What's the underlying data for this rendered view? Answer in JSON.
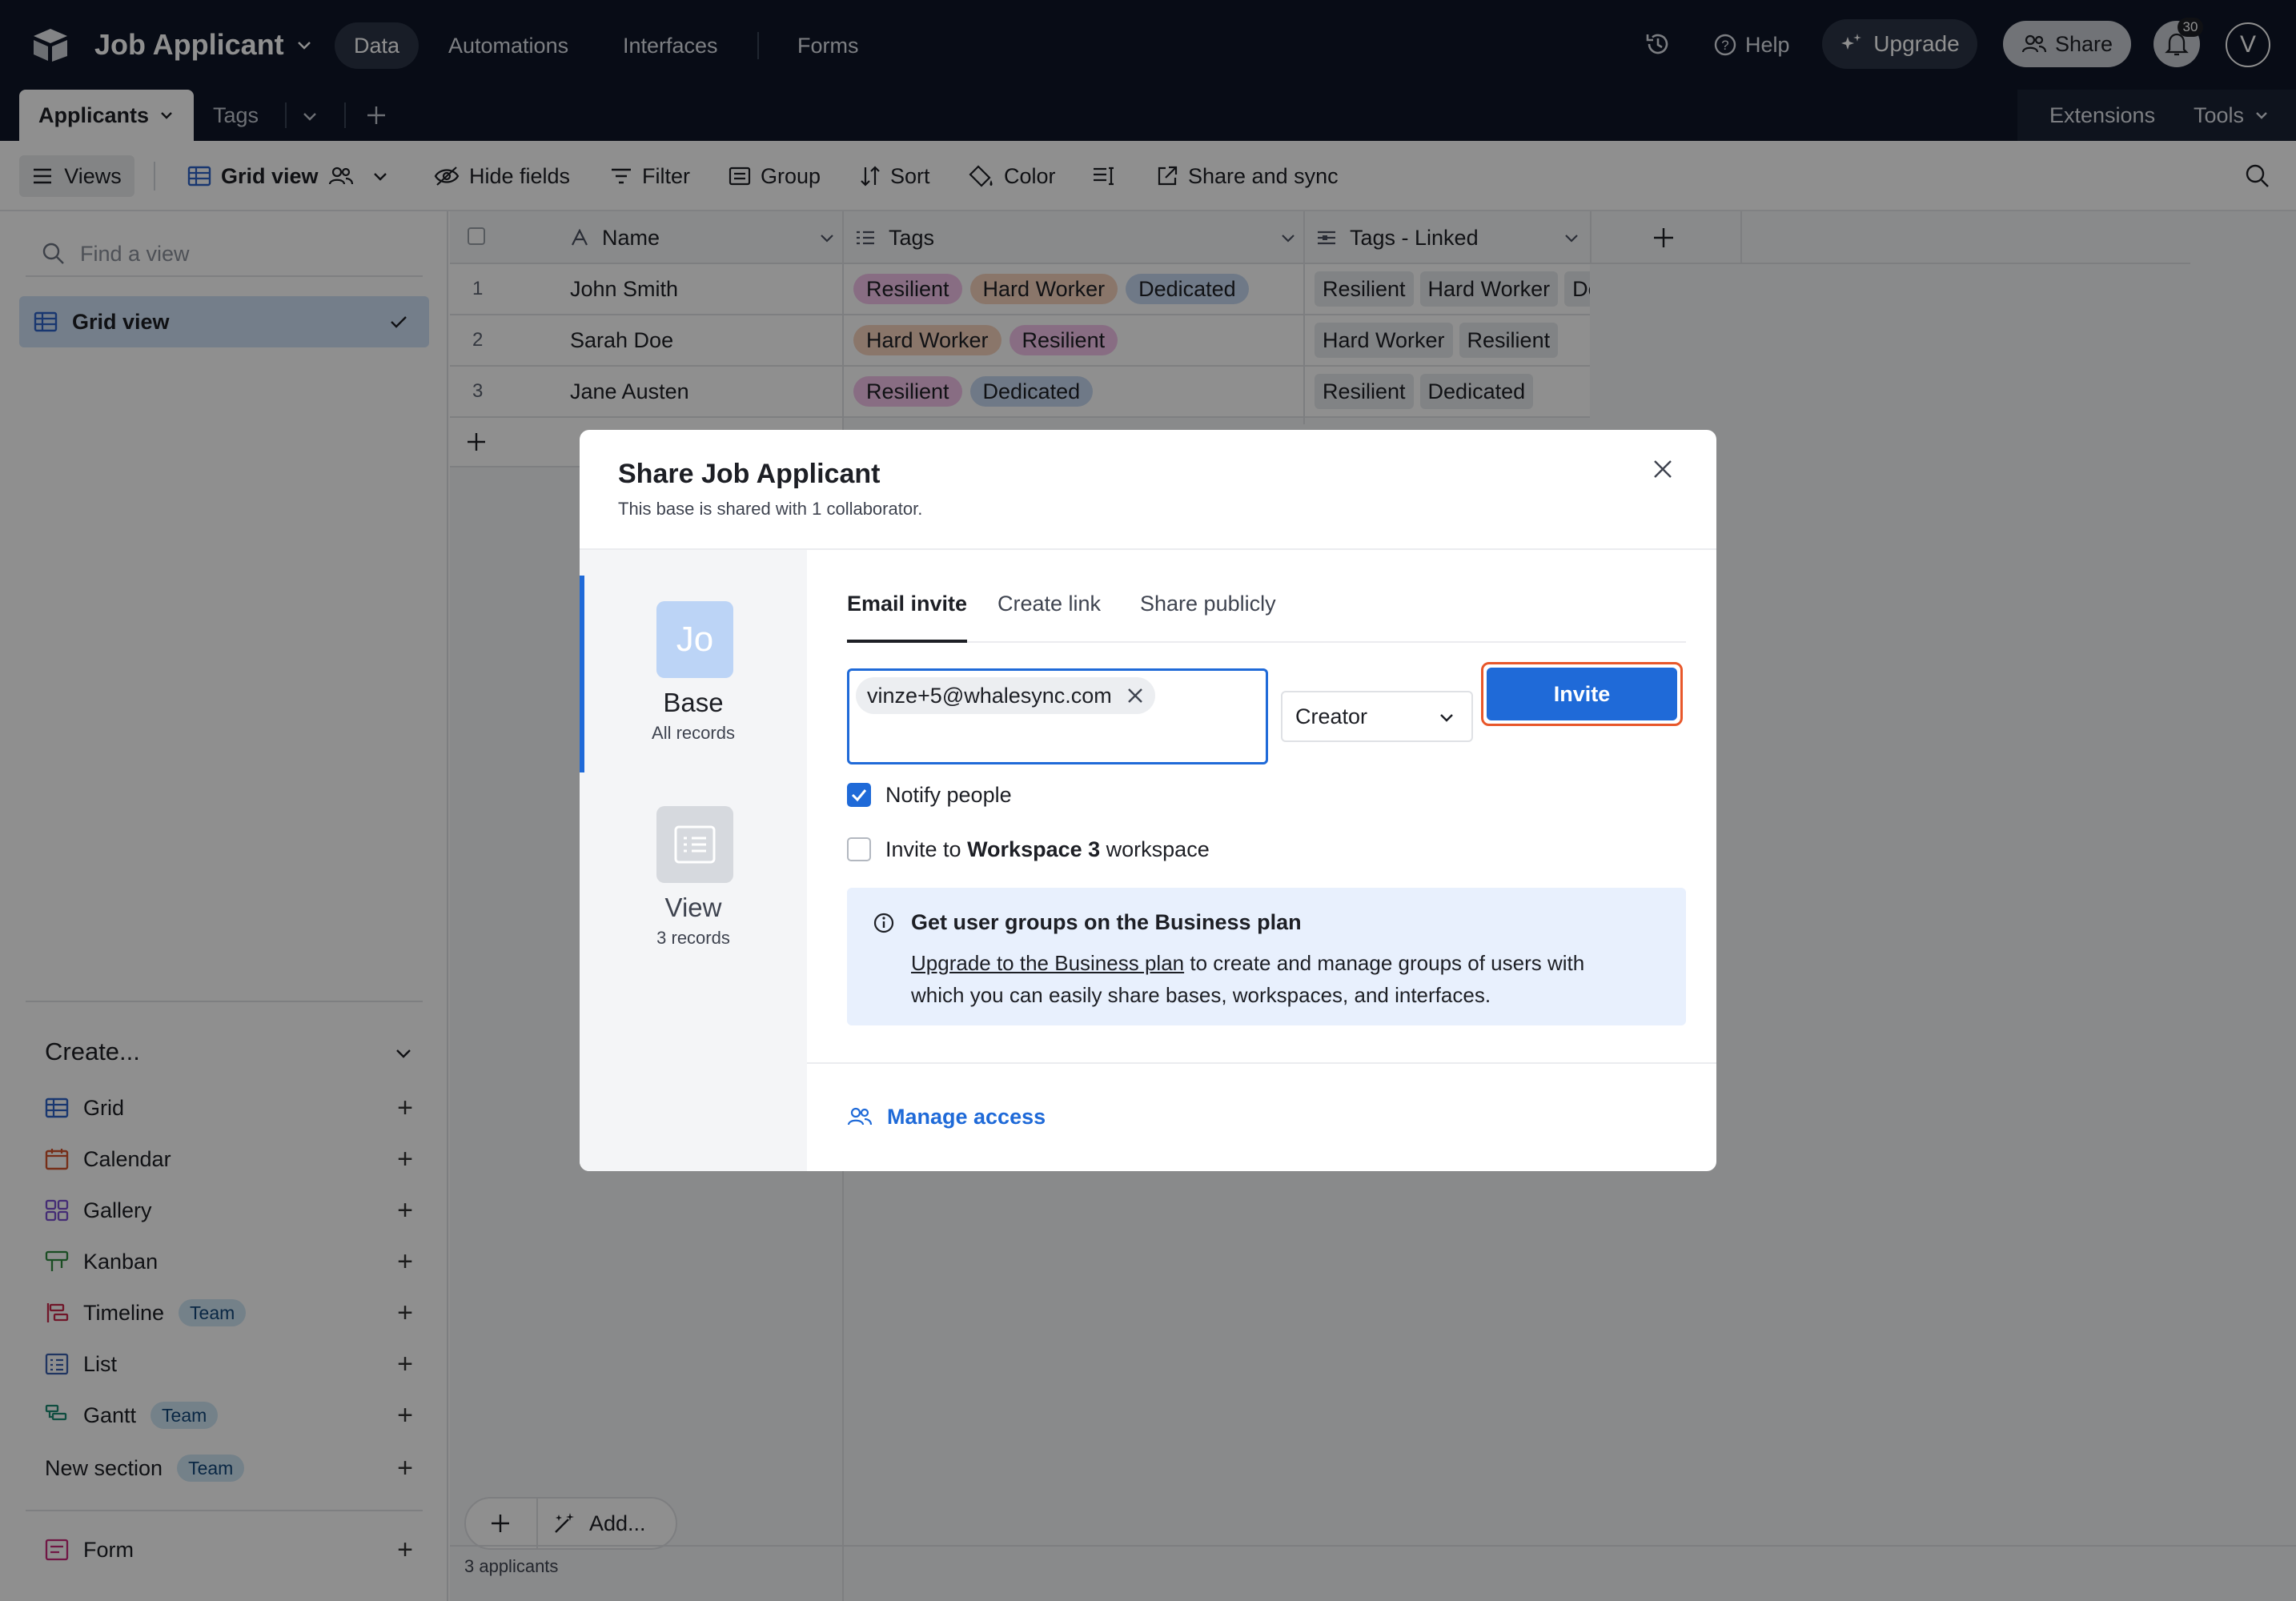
{
  "app": {
    "base_title": "Job Applicant",
    "nav": [
      "Data",
      "Automations",
      "Interfaces",
      "Forms"
    ],
    "help_label": "Help",
    "upgrade_label": "Upgrade",
    "share_label": "Share",
    "notification_count": "30",
    "avatar_initial": "V"
  },
  "tables": {
    "active": "Applicants",
    "other": "Tags",
    "extensions_label": "Extensions",
    "tools_label": "Tools"
  },
  "toolbar": {
    "views_label": "Views",
    "grid_view_label": "Grid view",
    "hide_fields": "Hide fields",
    "filter": "Filter",
    "group": "Group",
    "sort": "Sort",
    "color": "Color",
    "share_sync": "Share and sync"
  },
  "sidebar": {
    "find_placeholder": "Find a view",
    "active_view": "Grid view",
    "create_label": "Create...",
    "create_items": [
      {
        "label": "Grid",
        "badge": ""
      },
      {
        "label": "Calendar",
        "badge": ""
      },
      {
        "label": "Gallery",
        "badge": ""
      },
      {
        "label": "Kanban",
        "badge": ""
      },
      {
        "label": "Timeline",
        "badge": "Team"
      },
      {
        "label": "List",
        "badge": ""
      },
      {
        "label": "Gantt",
        "badge": "Team"
      },
      {
        "label": "New section",
        "badge": "Team"
      },
      {
        "label": "Form",
        "badge": ""
      }
    ]
  },
  "grid": {
    "columns": [
      "Name",
      "Tags",
      "Tags - Linked"
    ],
    "rows": [
      {
        "num": "1",
        "name": "John Smith",
        "tags": [
          "Resilient",
          "Hard Worker",
          "Dedicated"
        ],
        "linked": [
          "Resilient",
          "Hard Worker",
          "Dedicated"
        ]
      },
      {
        "num": "2",
        "name": "Sarah Doe",
        "tags": [
          "Hard Worker",
          "Resilient"
        ],
        "linked": [
          "Hard Worker",
          "Resilient"
        ]
      },
      {
        "num": "3",
        "name": "Jane Austen",
        "tags": [
          "Resilient",
          "Dedicated"
        ],
        "linked": [
          "Resilient",
          "Dedicated"
        ]
      }
    ],
    "tag_colors": {
      "Resilient": "#f2c3e9",
      "Hard Worker": "#f6d2be",
      "Dedicated": "#c6d8f0"
    },
    "add_label": "Add...",
    "record_count": "3 applicants"
  },
  "modal": {
    "title": "Share Job Applicant",
    "subtitle": "This base is shared with 1 collaborator.",
    "base_tile": {
      "initials": "Jo",
      "label": "Base",
      "sub": "All records"
    },
    "view_tile": {
      "label": "View",
      "sub": "3 records"
    },
    "tabs": [
      "Email invite",
      "Create link",
      "Share publicly"
    ],
    "email_chip": "vinze+5@whalesync.com",
    "role": "Creator",
    "invite_label": "Invite",
    "notify_label": "Notify people",
    "notify_checked": true,
    "invite_ws_prefix": "Invite to ",
    "invite_ws_name": "Workspace 3",
    "invite_ws_suffix": " workspace",
    "info_title": "Get user groups on the Business plan",
    "info_link": "Upgrade to the Business plan",
    "info_text_1": " to create and manage groups of users with",
    "info_text_2": "which you can easily share bases, workspaces, and interfaces.",
    "manage_access": "Manage access"
  },
  "colors": {
    "accent": "#1f6ad8",
    "dark_bar": "#0f1728",
    "focus_ring": "#e8572a"
  }
}
